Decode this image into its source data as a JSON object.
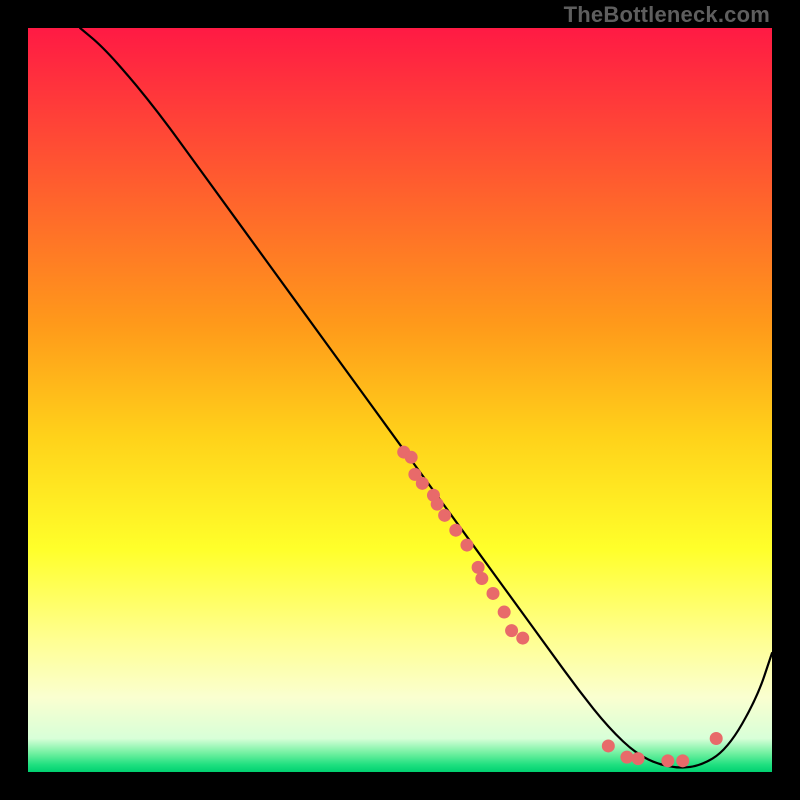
{
  "watermark": "TheBottleneck.com",
  "chart_data": {
    "type": "line",
    "title": "",
    "xlabel": "",
    "ylabel": "",
    "xlim": [
      0,
      100
    ],
    "ylim": [
      0,
      100
    ],
    "grid": false,
    "legend": false,
    "background_gradient": {
      "stops": [
        {
          "offset": 0.0,
          "color": "#ff1a44"
        },
        {
          "offset": 0.1,
          "color": "#ff3a3a"
        },
        {
          "offset": 0.25,
          "color": "#ff6a2a"
        },
        {
          "offset": 0.4,
          "color": "#ff9a1a"
        },
        {
          "offset": 0.55,
          "color": "#ffd21a"
        },
        {
          "offset": 0.7,
          "color": "#ffff2a"
        },
        {
          "offset": 0.82,
          "color": "#ffff90"
        },
        {
          "offset": 0.9,
          "color": "#faffd0"
        },
        {
          "offset": 0.955,
          "color": "#d8ffd8"
        },
        {
          "offset": 0.975,
          "color": "#70f0a0"
        },
        {
          "offset": 0.99,
          "color": "#20e080"
        },
        {
          "offset": 1.0,
          "color": "#00d070"
        }
      ]
    },
    "series": [
      {
        "name": "bottleneck-curve",
        "type": "line",
        "color": "#000000",
        "width": 2.2,
        "x": [
          7,
          10,
          14,
          18,
          22,
          26,
          30,
          34,
          38,
          42,
          46,
          50,
          54,
          58,
          62,
          66,
          70,
          74,
          78,
          82,
          86,
          90,
          94,
          98,
          100
        ],
        "y": [
          100,
          97.5,
          93,
          88,
          82.5,
          77,
          71.5,
          66,
          60.5,
          55,
          49.5,
          44,
          38.5,
          33,
          27.5,
          22,
          16.5,
          11,
          6,
          2.2,
          0.6,
          0.6,
          3,
          10,
          16
        ]
      }
    ],
    "scatter": {
      "name": "benchmark-points",
      "color": "#e86a6a",
      "radius": 6.5,
      "points": [
        {
          "x": 50.5,
          "y": 43.0
        },
        {
          "x": 51.5,
          "y": 42.3
        },
        {
          "x": 52.0,
          "y": 40.0
        },
        {
          "x": 53.0,
          "y": 38.8
        },
        {
          "x": 54.5,
          "y": 37.2
        },
        {
          "x": 55.0,
          "y": 36.0
        },
        {
          "x": 56.0,
          "y": 34.5
        },
        {
          "x": 57.5,
          "y": 32.5
        },
        {
          "x": 59.0,
          "y": 30.5
        },
        {
          "x": 60.5,
          "y": 27.5
        },
        {
          "x": 61.0,
          "y": 26.0
        },
        {
          "x": 62.5,
          "y": 24.0
        },
        {
          "x": 64.0,
          "y": 21.5
        },
        {
          "x": 65.0,
          "y": 19.0
        },
        {
          "x": 66.5,
          "y": 18.0
        },
        {
          "x": 78.0,
          "y": 3.5
        },
        {
          "x": 80.5,
          "y": 2.0
        },
        {
          "x": 82.0,
          "y": 1.8
        },
        {
          "x": 86.0,
          "y": 1.5
        },
        {
          "x": 88.0,
          "y": 1.5
        },
        {
          "x": 92.5,
          "y": 4.5
        }
      ]
    }
  }
}
